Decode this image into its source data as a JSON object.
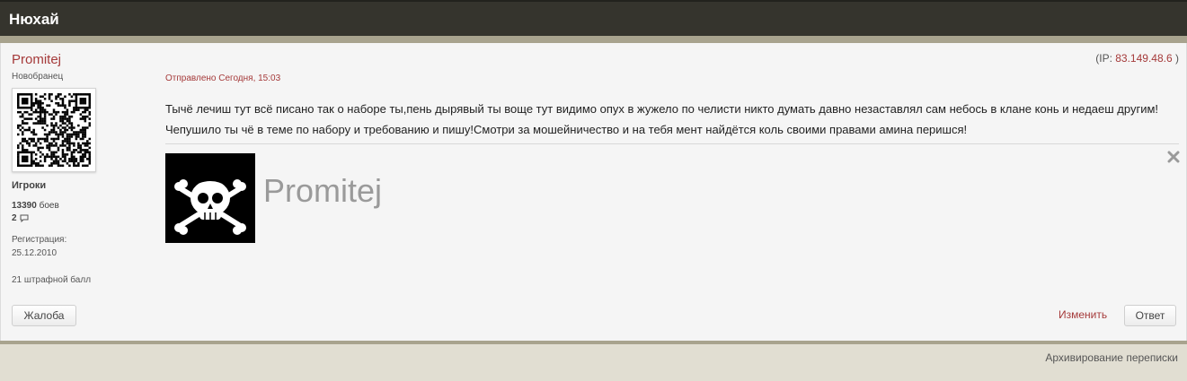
{
  "topic": {
    "title": "Нюхай"
  },
  "author": {
    "name": "Promitej",
    "rank": "Новобранец",
    "group": "Игроки",
    "battles_count": "13390",
    "battles_label": "боев",
    "posts_count": "2",
    "registration_label": "Регистрация:",
    "registration_date": "25.12.2010",
    "penalty": "21 штрафной балл"
  },
  "post": {
    "ip_prefix": "(IP: ",
    "ip": "83.149.48.6",
    "ip_suffix": " )",
    "posted": "Отправлено Сегодня, 15:03",
    "text": "Тычё лечиш тут всё писано так о наборе ты,пень дырявый ты воще тут видимо опух в жужело по челисти никто думать давно незаставлял сам небось в клане конь и недаеш другим!Чепушило ты чё в теме по набору и требованию и пишу!Смотри за мошейничество и на тебя мент найдётся коль своими правами амина перишся!",
    "signature_name": "Promitej"
  },
  "actions": {
    "complain": "Жалоба",
    "edit": "Изменить",
    "reply": "Ответ"
  },
  "footer": {
    "archive": "Архивирование переписки"
  },
  "colors": {
    "accent": "#a53a3a",
    "header_bg": "#35342d",
    "band": "#a8a38e"
  },
  "icons": {
    "posts": "speech-bubble-icon",
    "close": "close-icon",
    "avatar": "qr-code-avatar",
    "signature": "pirate-skull-image"
  }
}
